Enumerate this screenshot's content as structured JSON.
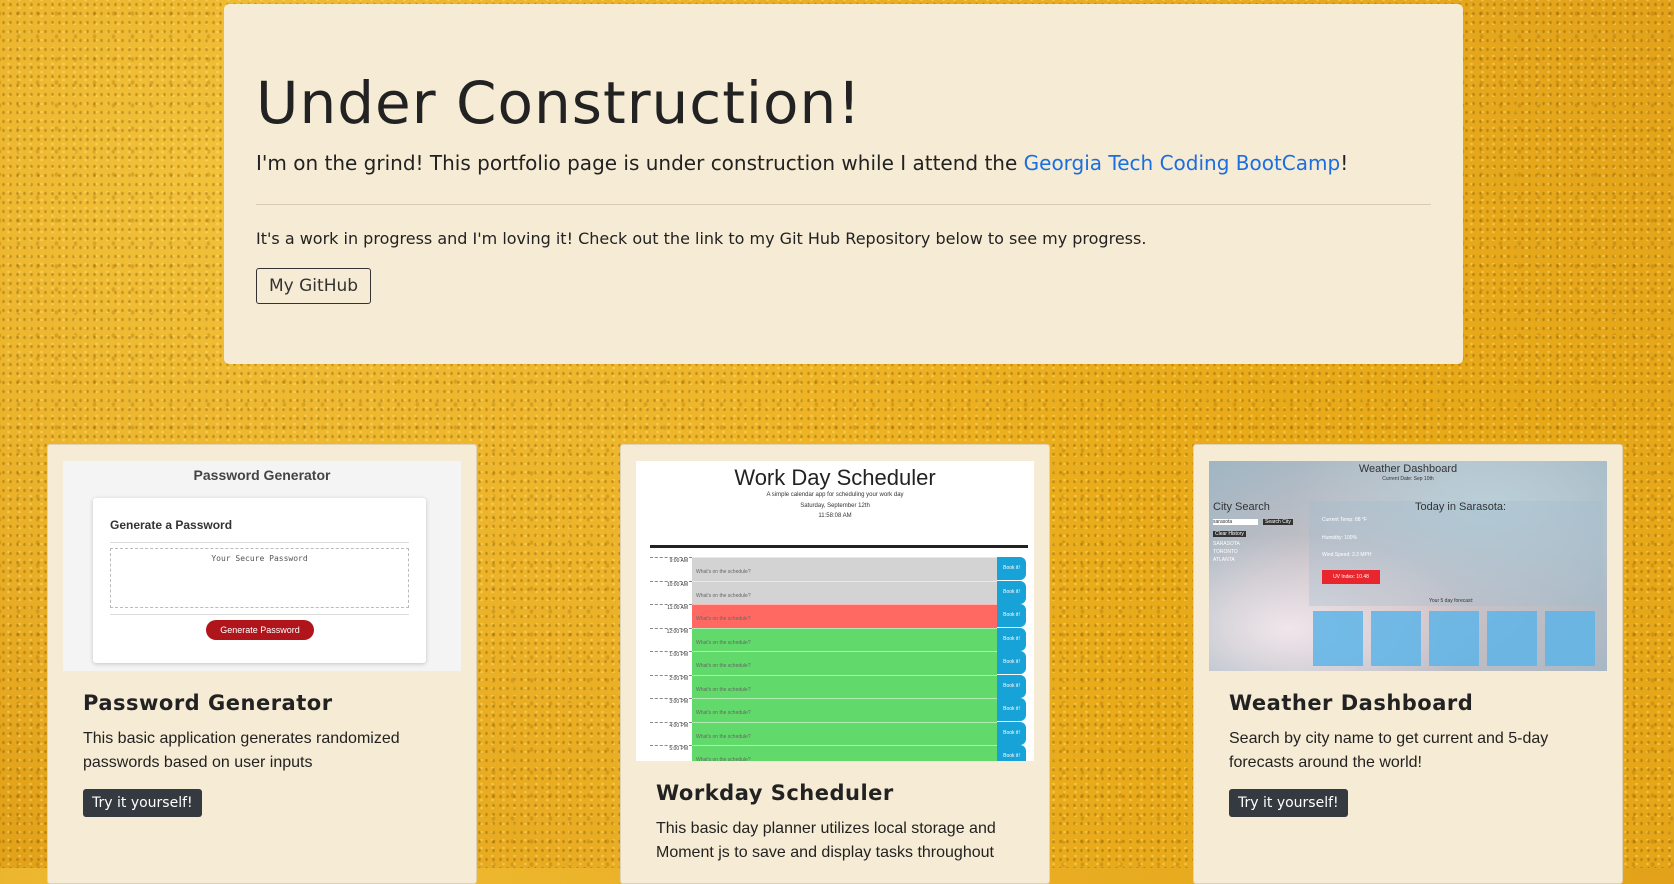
{
  "jumbotron": {
    "title": "Under Construction!",
    "lead_before": "I'm on the grind! This portfolio page is under construction while I attend the ",
    "lead_link": "Georgia Tech Coding BootCamp",
    "lead_after": "!",
    "body": "It's a work in progress and I'm loving it! Check out the link to my Git Hub Repository below to see my progress.",
    "button": "My GitHub"
  },
  "cards": [
    {
      "title": "Password Generator",
      "text": "This basic application generates randomized passwords based on user inputs",
      "button": "Try it yourself!",
      "thumb": {
        "title": "Password Generator",
        "heading": "Generate a Password",
        "placeholder": "Your Secure Password",
        "button": "Generate Password"
      }
    },
    {
      "title": "Workday Scheduler",
      "text": "This basic day planner utilizes local storage and Moment js to save and display tasks throughout",
      "thumb": {
        "title": "Work Day Scheduler",
        "subtitle": "A simple calendar app for scheduling your work day",
        "date": "Saturday, September 12th",
        "time": "11:58:08 AM",
        "placeholder": "What's on the schedule?",
        "book": "Book it!",
        "hours": [
          {
            "label": "9:00 AM",
            "state": "past"
          },
          {
            "label": "10:00 AM",
            "state": "past"
          },
          {
            "label": "11:00 AM",
            "state": "present"
          },
          {
            "label": "12:00 PM",
            "state": "future"
          },
          {
            "label": "1:00 PM",
            "state": "future"
          },
          {
            "label": "2:00 PM",
            "state": "future"
          },
          {
            "label": "3:00 PM",
            "state": "future"
          },
          {
            "label": "4:00 PM",
            "state": "future"
          },
          {
            "label": "5:00 PM",
            "state": "future"
          }
        ]
      }
    },
    {
      "title": "Weather Dashboard",
      "text": "Search by city name to get current and 5-day forecasts around the world!",
      "button": "Try it yourself!",
      "thumb": {
        "title": "Weather Dashboard",
        "date": "Current Date: Sep 10th",
        "city_search": "City Search",
        "today": "Today in Sarasota:",
        "temp": "Current Temp: 88 °F",
        "humidity": "Humidity: 100%",
        "wind": "Wind Speed: 3.3 MPH",
        "uv": "UV Index: 10.48",
        "forecast_title": "Your 5 day forecast:",
        "search_value": "sarasota",
        "search_button": "Search City",
        "clear_button": "Clear History",
        "history": [
          "SARASOTA",
          "TORONTO",
          "ATLANTA"
        ]
      }
    }
  ]
}
